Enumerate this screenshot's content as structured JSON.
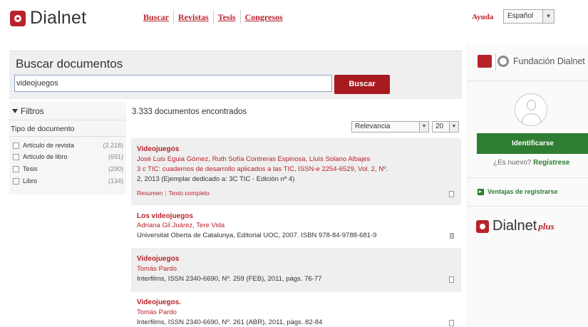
{
  "header": {
    "logo_text": "Dialnet",
    "nav": [
      {
        "label": "Buscar"
      },
      {
        "label": "Revistas"
      },
      {
        "label": "Tesis"
      },
      {
        "label": "Congresos"
      }
    ],
    "help_label": "Ayuda",
    "language": "Español"
  },
  "search": {
    "title": "Buscar documentos",
    "value": "videojuegos",
    "button": "Buscar"
  },
  "filters": {
    "heading": "Filtros",
    "group_title": "Tipo de documento",
    "items": [
      {
        "label": "Artículo de revista",
        "count": "(2.218)"
      },
      {
        "label": "Artículo de libro",
        "count": "(691)"
      },
      {
        "label": "Tesis",
        "count": "(290)"
      },
      {
        "label": "Libro",
        "count": "(134)"
      }
    ]
  },
  "results": {
    "count_text": "3.333 documentos encontrados",
    "sort": "Relevancia",
    "page_size": "20",
    "items": [
      {
        "title": "Videojuegos",
        "authors": "José Luis Eguia Gómez, Ruth Sofía Contreras Espinosa, Lluís Solano Albajes",
        "source_line1": "3 c TIC: cuadernos de desarrollo aplicados a las TIC, ISSN-e 2254-6529, Vol. 2, Nº.",
        "source_line2": "2, 2013 (Ejemplar dedicado a: 3C TIC - Edición nº 4)",
        "link_resumen": "Resumen",
        "link_texto": "Texto completo"
      },
      {
        "title": "Los videojuegos",
        "authors": "Adriana Gil Juárez, Tere Vida",
        "source_line1": "Universitat Oberta de Catalunya, Editorial UOC, 2007. ISBN 978-84-9788-681-9"
      },
      {
        "title": "Videojuegos",
        "authors": "Tomás Pardo",
        "source_line1": "Interfilms, ISSN 2340-6690, Nº. 259 (FEB), 2011, págs. 76-77"
      },
      {
        "title": "Videojuegos.",
        "authors": "Tomás Pardo",
        "source_line1": "Interfilms, ISSN 2340-6690, Nº. 261 (ABR), 2011, págs. 82-84"
      }
    ]
  },
  "sidebar": {
    "fundacion": "Fundación Dialnet",
    "identify_button": "Identificarse",
    "new_q": "¿Es nuevo?",
    "register": "Regístrese",
    "ventajas": "Ventajas de registrarse",
    "plus_text": "Dialnet",
    "plus_sub": "plus"
  }
}
